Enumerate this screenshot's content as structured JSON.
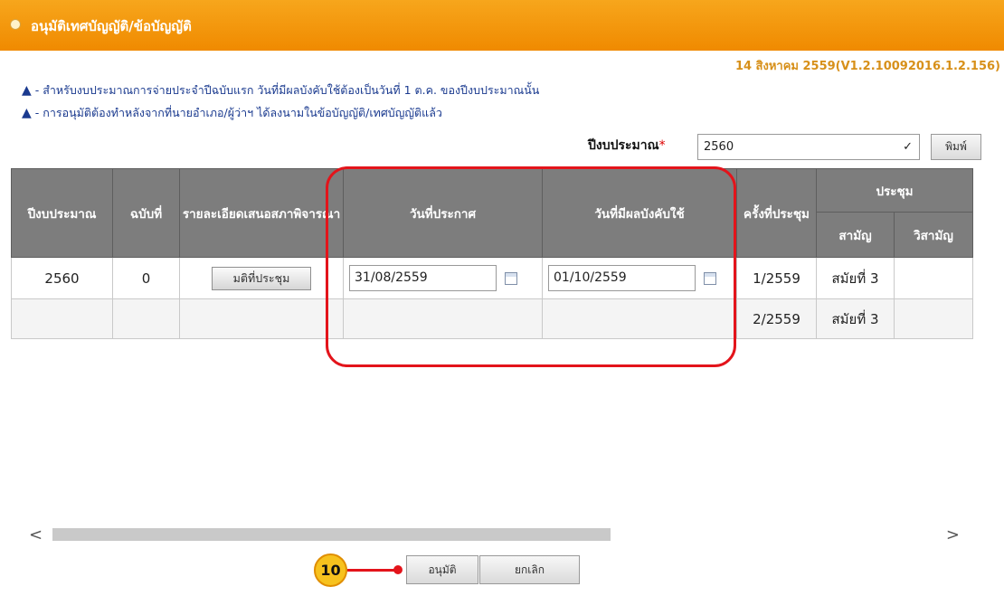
{
  "header": {
    "title": "อนุมัติเทศบัญญัติ/ข้อบัญญัติ",
    "version": "14 สิงหาคม 2559(V1.2.10092016.1.2.156)"
  },
  "notices": [
    "- สำหรับงบประมาณการจ่ายประจำปีฉบับแรก วันที่มีผลบังคับใช้ต้องเป็นวันที่ 1 ต.ค. ของปีงบประมาณนั้น",
    "- การอนุมัติต้องทำหลังจากที่นายอำเภอ/ผู้ว่าฯ ได้ลงนามในข้อบัญญัติ/เทศบัญญัติแล้ว"
  ],
  "filter": {
    "label": "ปีงบประมาณ",
    "required_mark": "*",
    "selected_year": "2560",
    "print_label": "พิมพ์"
  },
  "table": {
    "headers": {
      "fiscal_year": "ปีงบประมาณ",
      "edition": "ฉบับที่",
      "council_detail": "รายละเอียดเสนอสภาพิจารณา",
      "announce_date": "วันที่ประกาศ",
      "effective_date": "วันที่มีผลบังคับใช้",
      "meeting_no": "ครั้งที่ประชุม",
      "session": "ประชุม",
      "ordinary": "สามัญ",
      "extraordinary": "วิสามัญ"
    },
    "rows": [
      {
        "fiscal_year": "2560",
        "edition": "0",
        "detail_button": "มติที่ประชุม",
        "announce_date": "31/08/2559",
        "effective_date": "01/10/2559",
        "meeting_no": "1/2559",
        "ordinary": "สมัยที่ 3",
        "extraordinary": ""
      },
      {
        "fiscal_year": "",
        "edition": "",
        "detail_button": "",
        "announce_date": "",
        "effective_date": "",
        "meeting_no": "2/2559",
        "ordinary": "สมัยที่ 3",
        "extraordinary": ""
      }
    ]
  },
  "actions": {
    "approve": "อนุมัติ",
    "cancel": "ยกเลิก"
  },
  "annotation": {
    "step": "10"
  },
  "icons": {
    "warning": "warning-icon",
    "calendar": "calendar-icon",
    "scroll_left": "chevron-left-icon",
    "scroll_right": "chevron-right-icon"
  },
  "colors": {
    "header_orange": "#f08a00",
    "table_header": "#7d7d7d",
    "highlight_red": "#e3141b",
    "badge_yellow": "#f7c21e"
  }
}
